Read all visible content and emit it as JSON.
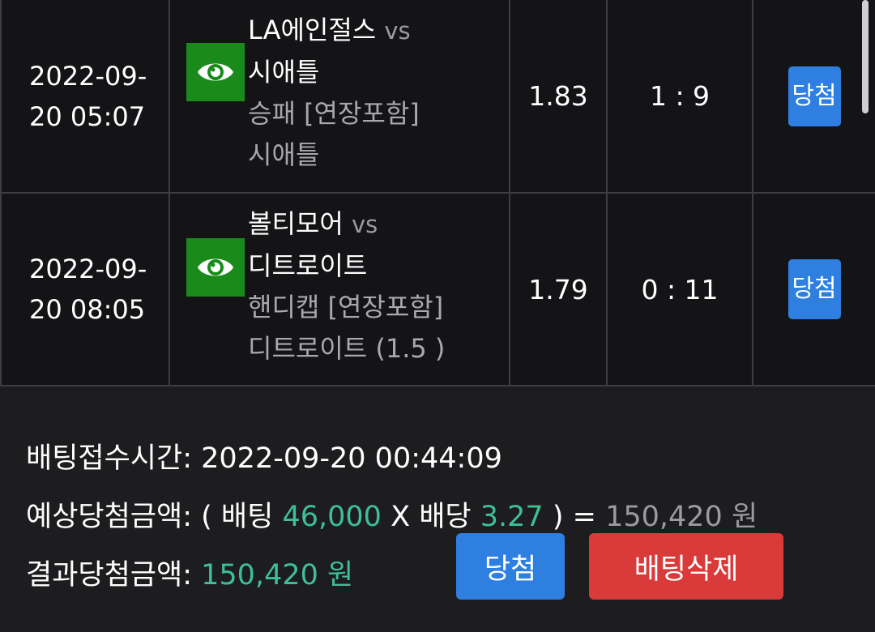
{
  "rows": [
    {
      "time_line1": "2022-09-",
      "time_line2": "20 05:07",
      "team_home": "LA에인절스",
      "vs": "vs",
      "team_away": "시애틀",
      "market": "승패 [연장포함]",
      "pick": "시애틀",
      "odds": "1.83",
      "score": "1 : 9",
      "result": "당첨"
    },
    {
      "time_line1": "2022-09-",
      "time_line2": "20 08:05",
      "team_home": "볼티모어",
      "vs": "vs",
      "team_away": "디트로이트",
      "market": "핸디캡 [연장포함]",
      "pick": "디트로이트 (1.5 )",
      "odds": "1.79",
      "score": "0 : 11",
      "result": "당첨"
    }
  ],
  "summary": {
    "bet_time_label": "배팅접수시간:",
    "bet_time_value": "2022-09-20 00:44:09",
    "expected_label": "예상당첨금액:",
    "expected_open": "( 배팅",
    "bet_amount": "46,000",
    "times": "X",
    "odds_label": "배당",
    "total_odds": "3.27",
    "expected_close": ") =",
    "expected_amount": "150,420 원",
    "result_label": "결과당첨금액:",
    "result_amount": "150,420 원"
  },
  "buttons": {
    "win_label": "당첨",
    "delete_label": "배팅삭제"
  },
  "colors": {
    "accent_blue": "#2f7fe0",
    "delete_red": "#d93a3a",
    "money_green": "#3fbf95",
    "eye_green": "#1a8a1a"
  },
  "icons": {
    "view": "eye-icon"
  }
}
